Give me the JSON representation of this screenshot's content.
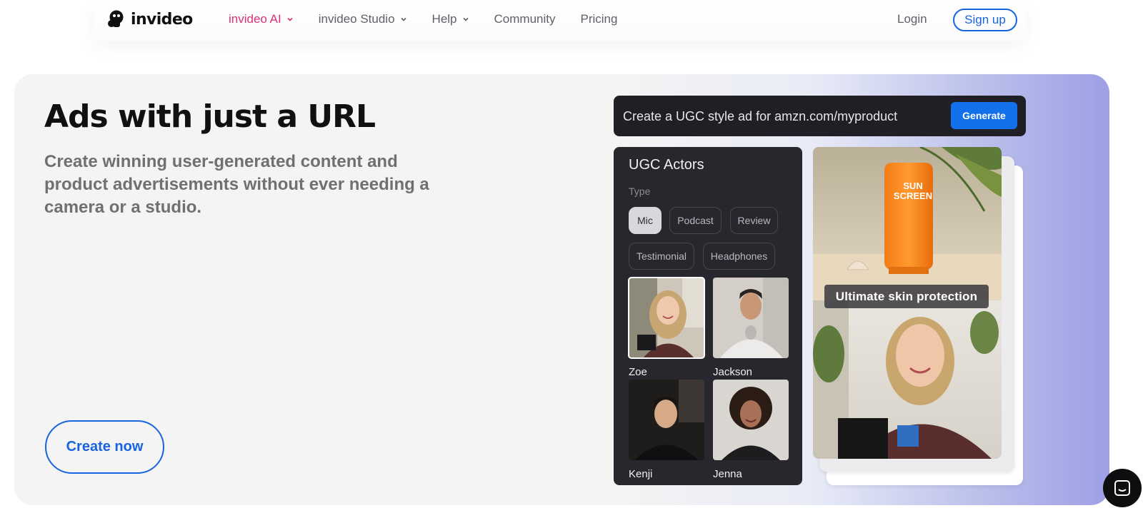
{
  "brand": {
    "name": "invideo"
  },
  "nav": {
    "items": [
      {
        "label": "invideo AI",
        "dropdown": true,
        "active": true
      },
      {
        "label": "invideo Studio",
        "dropdown": true
      },
      {
        "label": "Help",
        "dropdown": true
      },
      {
        "label": "Community",
        "dropdown": false
      },
      {
        "label": "Pricing",
        "dropdown": false
      }
    ],
    "login": "Login",
    "signup": "Sign up"
  },
  "hero": {
    "headline": "Ads with just a URL",
    "subtext": "Create winning user-generated content and product advertisements without ever needing a camera or a studio.",
    "cta": "Create now"
  },
  "prompt": {
    "text": "Create a UGC style ad for amzn.com/myproduct",
    "button": "Generate"
  },
  "actors_panel": {
    "title": "UGC Actors",
    "type_label": "Type",
    "types": [
      "Mic",
      "Podcast",
      "Review",
      "Testimonial",
      "Headphones"
    ],
    "selected_type": "Mic",
    "actors": [
      "Zoe",
      "Jackson",
      "Kenji",
      "Jenna"
    ],
    "selected_actor": "Zoe"
  },
  "preview": {
    "caption": "Ultimate skin protection",
    "product_label": "SUN SCREEN"
  },
  "colors": {
    "accent": "#d9317a",
    "primary": "#1763e0",
    "panel": "#27272d"
  }
}
